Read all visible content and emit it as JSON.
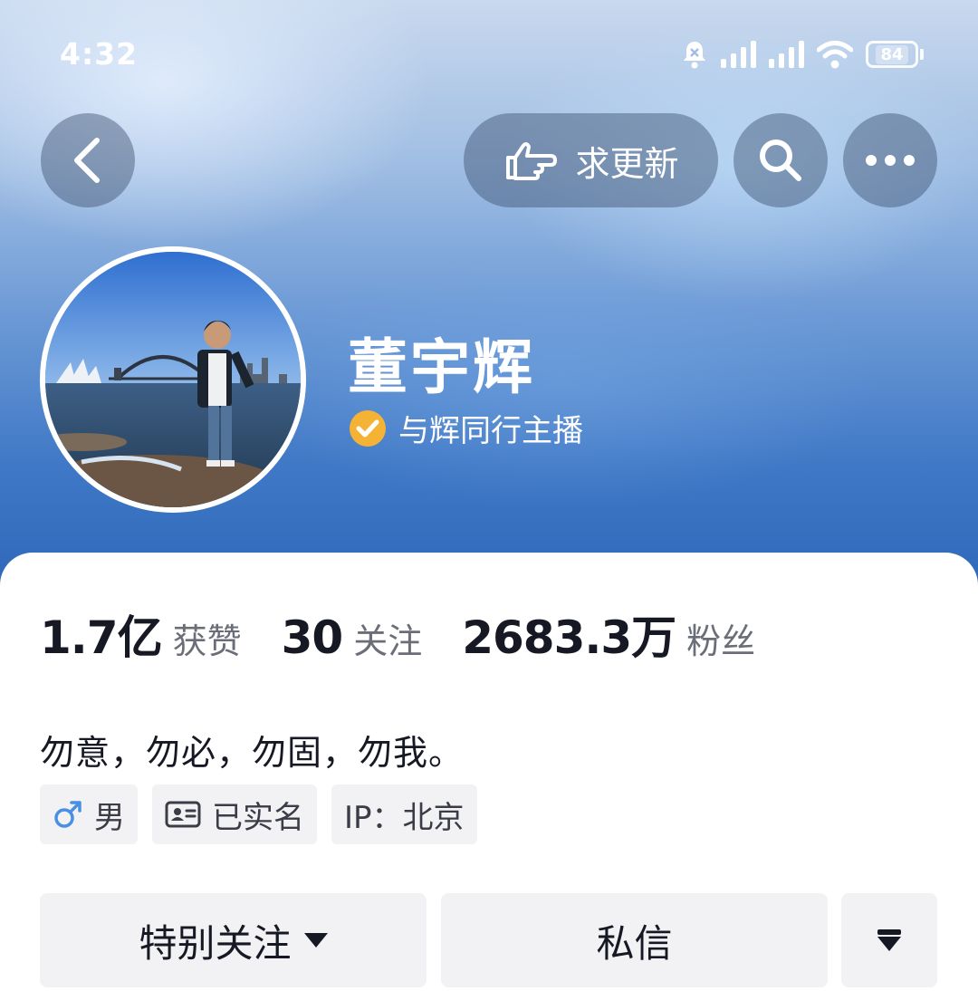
{
  "status_bar": {
    "time": "4:32",
    "battery": "84",
    "icons": [
      "notification-bell-icon",
      "signal-icon",
      "signal-icon",
      "wifi-icon",
      "battery-icon"
    ]
  },
  "top_bar": {
    "back_icon": "chevron-left-icon",
    "update_label": "求更新",
    "update_icon": "pointing-hand-icon",
    "search_icon": "search-icon",
    "more_icon": "more-dots-icon"
  },
  "profile": {
    "name": "董宇辉",
    "verified_title": "与辉同行主播",
    "verified_icon": "verified-check-icon",
    "bio": "勿意，勿必，勿固，勿我。"
  },
  "stats": [
    {
      "value": "1.7亿",
      "label": "获赞"
    },
    {
      "value": "30",
      "label": "关注"
    },
    {
      "value": "2683.3万",
      "label": "粉丝"
    }
  ],
  "tags": {
    "gender": "男",
    "realname": "已实名",
    "ip": "IP：北京"
  },
  "actions": {
    "follow": "特别关注",
    "message": "私信"
  },
  "colors": {
    "header_top": "#c9d9ee",
    "header_bottom": "#2e67b8",
    "verify_badge": "#f5b335",
    "male_icon": "#4a90e2",
    "button_bg": "#f2f2f4",
    "text_primary": "#161823",
    "text_secondary": "#6b6e78"
  }
}
